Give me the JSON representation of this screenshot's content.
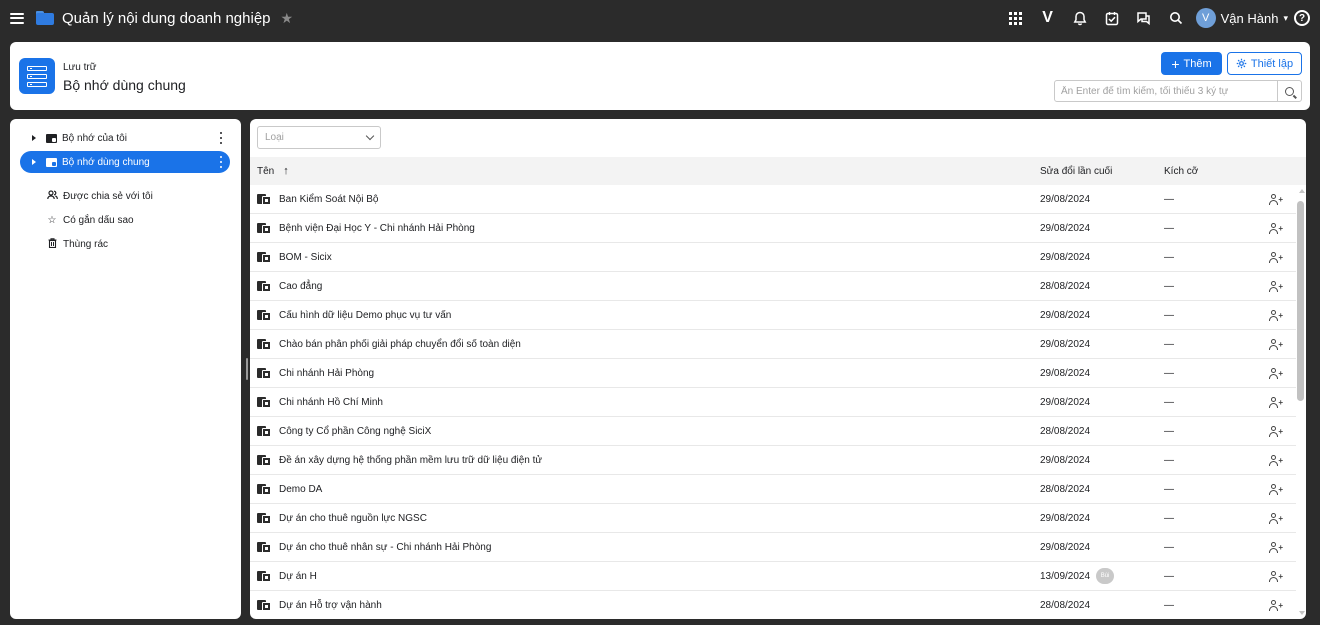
{
  "app": {
    "title": "Quản lý nội dung doanh nghiệp"
  },
  "topbar": {
    "brand_letter": "V",
    "user": {
      "initial": "V",
      "name": "Vận Hành"
    },
    "help": "?"
  },
  "header": {
    "breadcrumb": "Lưu trữ",
    "title": "Bộ nhớ dùng chung",
    "add_label": "Thêm",
    "setup_label": "Thiết lập",
    "search_placeholder": "Ấn Enter để tìm kiếm, tối thiểu 3 ký tự"
  },
  "sidebar": {
    "tree": [
      {
        "label": "Bộ nhớ của tôi",
        "active": false
      },
      {
        "label": "Bộ nhớ dùng chung",
        "active": true
      }
    ],
    "nav": [
      {
        "label": "Được chia sẻ với tôi",
        "icon": "people-icon"
      },
      {
        "label": "Có gắn dấu sao",
        "icon": "star-icon"
      },
      {
        "label": "Thùng rác",
        "icon": "trash-icon"
      }
    ]
  },
  "filter": {
    "placeholder": "Loại"
  },
  "table": {
    "columns": {
      "name": "Tên",
      "modified": "Sửa đổi lần cuối",
      "size": "Kích cỡ"
    },
    "sort_indicator": "↑",
    "rows": [
      {
        "name": "Ban Kiểm Soát Nội Bộ",
        "modified": "29/08/2024",
        "size": "—"
      },
      {
        "name": "Bệnh viện Đại Học Y - Chi nhánh Hải Phòng",
        "modified": "29/08/2024",
        "size": "—"
      },
      {
        "name": "BOM - Sicix",
        "modified": "29/08/2024",
        "size": "—"
      },
      {
        "name": "Cao đẳng",
        "modified": "28/08/2024",
        "size": "—"
      },
      {
        "name": "Cấu hình dữ liệu Demo phục vụ tư vấn",
        "modified": "29/08/2024",
        "size": "—"
      },
      {
        "name": "Chào bán phân phối giải pháp chuyển đổi số toàn diện",
        "modified": "29/08/2024",
        "size": "—"
      },
      {
        "name": "Chi nhánh Hải Phòng",
        "modified": "29/08/2024",
        "size": "—"
      },
      {
        "name": "Chi nhánh Hồ Chí Minh",
        "modified": "29/08/2024",
        "size": "—"
      },
      {
        "name": "Công ty Cổ phần Công nghệ SiciX",
        "modified": "28/08/2024",
        "size": "—"
      },
      {
        "name": "Đề án xây dựng hệ thống phần mềm lưu trữ dữ liệu điện tử",
        "modified": "29/08/2024",
        "size": "—"
      },
      {
        "name": "Demo DA",
        "modified": "28/08/2024",
        "size": "—"
      },
      {
        "name": "Dự án cho thuê nguồn lực NGSC",
        "modified": "29/08/2024",
        "size": "—"
      },
      {
        "name": "Dự án cho thuê nhân sự - Chi nhánh Hải Phòng",
        "modified": "29/08/2024",
        "size": "—"
      },
      {
        "name": "Dự án H",
        "modified": "13/09/2024",
        "size": "—",
        "badge": "Bùi"
      },
      {
        "name": "Dự án Hỗ trợ vận hành",
        "modified": "28/08/2024",
        "size": "—"
      }
    ]
  }
}
